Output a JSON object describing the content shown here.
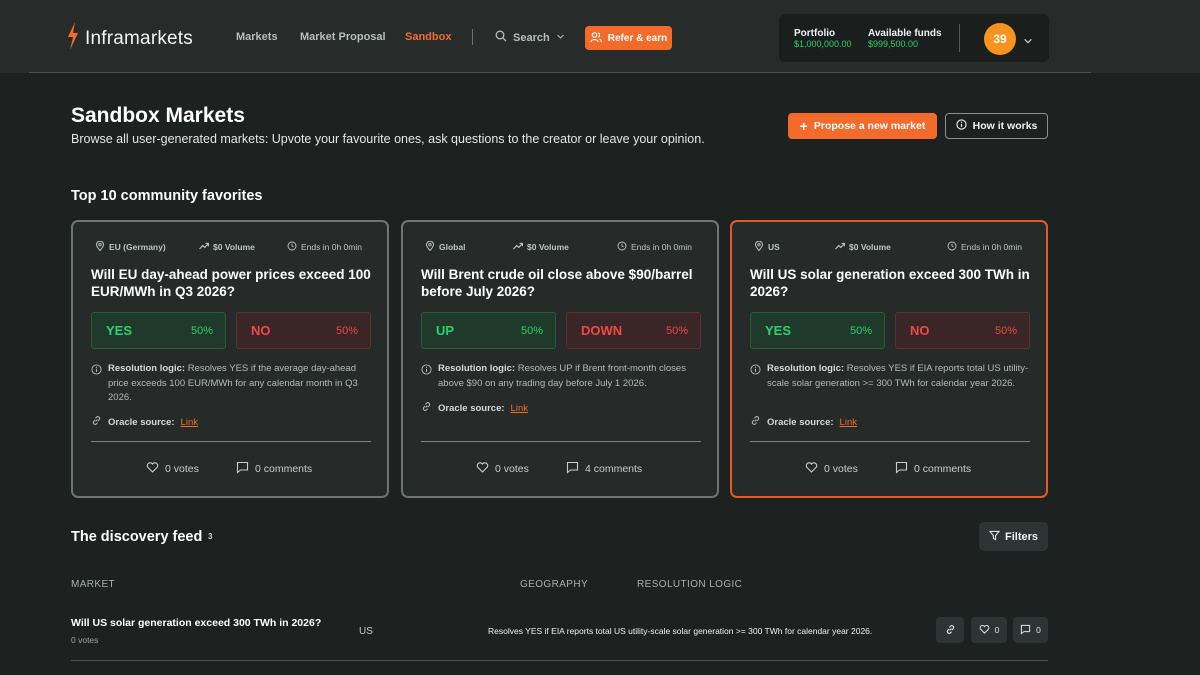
{
  "header": {
    "logo_text": "Inframarkets",
    "nav": [
      "Markets",
      "Market Proposal",
      "Sandbox"
    ],
    "active_nav": "Sandbox",
    "search_label": "Search",
    "refer_label": "Refer & earn",
    "portfolio_label": "Portfolio",
    "portfolio_value": "$1,000,000.00",
    "funds_label": "Available funds",
    "funds_value": "$999,500.00",
    "avatar_number": "39"
  },
  "page": {
    "title": "Sandbox Markets",
    "subtitle": "Browse all user-generated markets: Upvote your favourite ones, ask questions to the creator or leave your opinion.",
    "propose_label": "Propose a new market",
    "how_label": "How it works"
  },
  "favorites": {
    "title": "Top 10 community favorites",
    "cards": [
      {
        "region": "EU (Germany)",
        "volume": "$0 Volume",
        "ends": "Ends in 0h 0min",
        "question": "Will EU day-ahead power prices exceed 100 EUR/MWh in Q3 2026?",
        "opt_a": "YES",
        "opt_a_pct": "50%",
        "opt_b": "NO",
        "opt_b_pct": "50%",
        "res_label": "Resolution logic:",
        "res_text": "Resolves YES if the average day-ahead price exceeds 100 EUR/MWh for any calendar month in Q3 2026.",
        "oracle_label": "Oracle source:",
        "oracle_link": "Link",
        "votes": "0 votes",
        "comments": "0 comments"
      },
      {
        "region": "Global",
        "volume": "$0 Volume",
        "ends": "Ends in 0h 0min",
        "question": "Will Brent crude oil close above $90/barrel before July 2026?",
        "opt_a": "UP",
        "opt_a_pct": "50%",
        "opt_b": "DOWN",
        "opt_b_pct": "50%",
        "res_label": "Resolution logic:",
        "res_text": "Resolves UP if Brent front-month closes above $90 on any trading day before July 1 2026.",
        "oracle_label": "Oracle source:",
        "oracle_link": "Link",
        "votes": "0 votes",
        "comments": "4 comments"
      },
      {
        "region": "US",
        "volume": "$0 Volume",
        "ends": "Ends in 0h 0min",
        "question": "Will US solar generation exceed 300 TWh in 2026?",
        "opt_a": "YES",
        "opt_a_pct": "50%",
        "opt_b": "NO",
        "opt_b_pct": "50%",
        "res_label": "Resolution logic:",
        "res_text": "Resolves YES if EIA reports total US utility-scale solar generation >= 300 TWh for calendar year 2026.",
        "oracle_label": "Oracle source:",
        "oracle_link": "Link",
        "votes": "0 votes",
        "comments": "0 comments"
      }
    ]
  },
  "feed": {
    "title": "The discovery feed",
    "count": "3",
    "filters_label": "Filters",
    "columns": [
      "MARKET",
      "GEOGRAPHY",
      "RESOLUTION LOGIC"
    ],
    "rows": [
      {
        "title": "Will US solar generation exceed 300 TWh in 2026?",
        "votes": "0 votes",
        "geography": "US",
        "resolution": "Resolves YES if EIA reports total US utility-scale solar generation >= 300 TWh for calendar year 2026.",
        "vote_count": "0",
        "comment_count": "0"
      }
    ]
  },
  "colors": {
    "accent": "#f26b2a",
    "positive": "#2ed06e",
    "negative": "#ec4b46",
    "background": "#1d2120",
    "header_bg": "#272c2b"
  }
}
